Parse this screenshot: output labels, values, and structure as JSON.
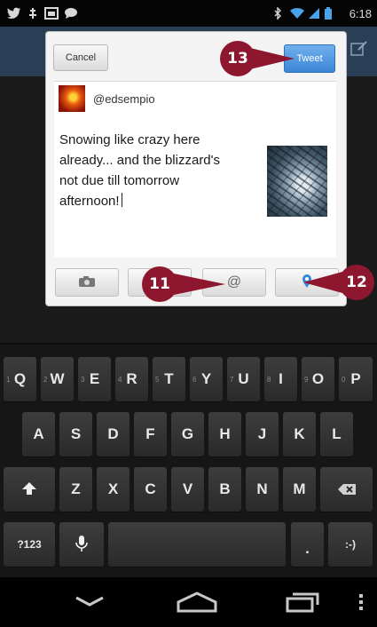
{
  "status_bar": {
    "left_icons": [
      "twitter-icon",
      "usb-debug-icon",
      "image-icon",
      "chat-icon"
    ],
    "right_icons": [
      "bluetooth-icon",
      "wifi-icon",
      "signal-icon",
      "battery-icon"
    ],
    "time": "6:18"
  },
  "compose": {
    "cancel_label": "Cancel",
    "tweet_label": "Tweet",
    "handle": "@edsempio",
    "text_lines": [
      "Snowing like crazy here",
      "already... and the blizzard's",
      "not due till tomorrow",
      "afternoon!"
    ],
    "toolbar": [
      {
        "name": "camera",
        "glyph": "📷",
        "icon": "camera-icon"
      },
      {
        "name": "blank",
        "glyph": "",
        "icon": ""
      },
      {
        "name": "mention",
        "glyph": "@",
        "icon": "at-icon"
      },
      {
        "name": "location",
        "glyph": "📍",
        "icon": "location-pin-icon"
      }
    ]
  },
  "callouts": {
    "mention": "11",
    "location": "12",
    "tweet": "13",
    "color": "#8e1730"
  },
  "keyboard": {
    "row1": [
      "Q",
      "W",
      "E",
      "R",
      "T",
      "Y",
      "U",
      "I",
      "O",
      "P"
    ],
    "row1_hints": [
      "1",
      "2",
      "3",
      "4",
      "5",
      "6",
      "7",
      "8",
      "9",
      "0"
    ],
    "row2": [
      "A",
      "S",
      "D",
      "F",
      "G",
      "H",
      "J",
      "K",
      "L"
    ],
    "row3": [
      "Z",
      "X",
      "C",
      "V",
      "B",
      "N",
      "M"
    ],
    "shift_glyph": "⬆",
    "delete_glyph": "⌫",
    "symbols_label": "?123",
    "mic_glyph": "🎤",
    "period_label": ".",
    "smiley_label": ":-)"
  },
  "nav": {
    "back": "back-icon",
    "home": "home-icon",
    "recents": "recents-icon",
    "menu": "menu-dots-icon"
  }
}
